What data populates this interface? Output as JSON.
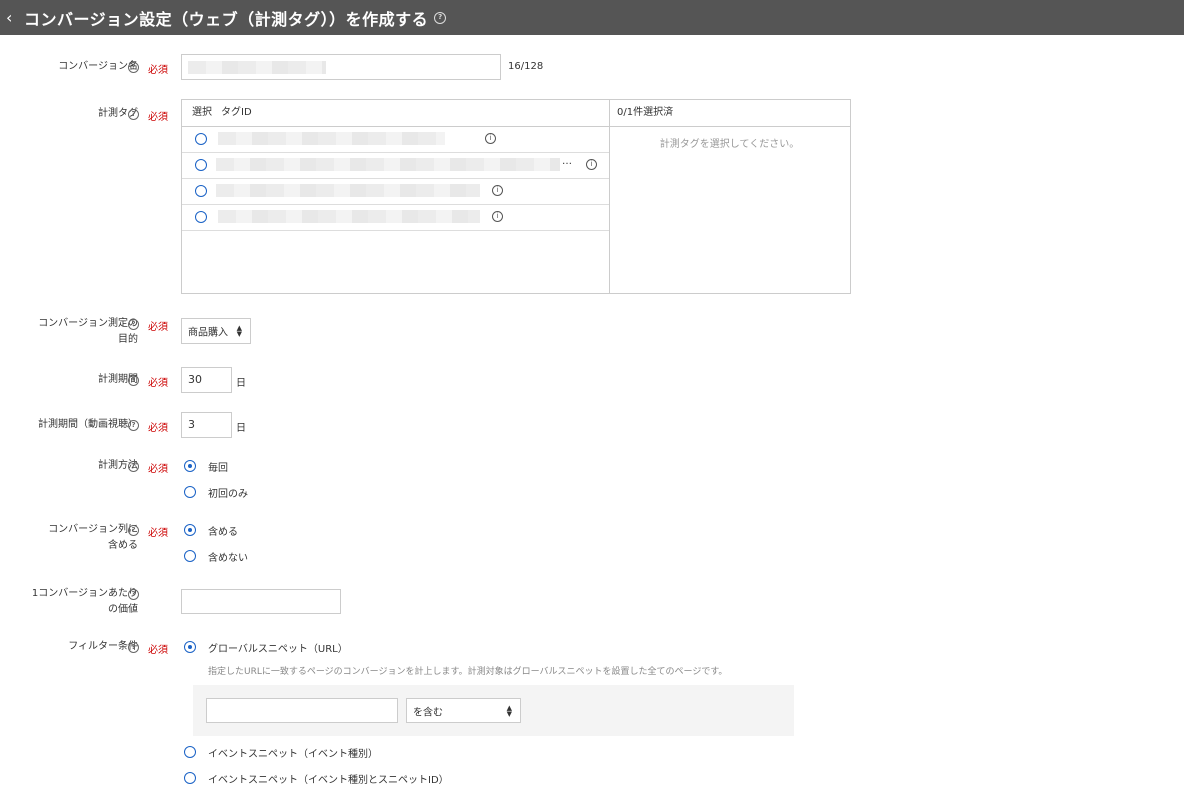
{
  "header": {
    "title": "コンバージョン設定（ウェブ（計測タグ））を作成する"
  },
  "required_label": "必須",
  "conversion_name": {
    "label": "コンバージョン名",
    "counter": "16/128"
  },
  "tag": {
    "label": "計測タグ",
    "col_select": "選択",
    "col_tag_id": "タグID",
    "selected_count": "0/1件選択済",
    "empty_message": "計測タグを選択してください。",
    "row2_ellipsis": "…"
  },
  "purpose": {
    "label_line1": "コンバージョン測定の",
    "label_line2": "目的",
    "value": "商品購入"
  },
  "period": {
    "label": "計測期間",
    "value": "30",
    "unit": "日"
  },
  "video_period": {
    "label": "計測期間（動画視聴）",
    "value": "3",
    "unit": "日"
  },
  "method": {
    "label": "計測方法",
    "options": [
      "毎回",
      "初回のみ"
    ],
    "selected": 0
  },
  "include": {
    "label_line1": "コンバージョン列に",
    "label_line2": "含める",
    "options": [
      "含める",
      "含めない"
    ],
    "selected": 0
  },
  "value_per": {
    "label_line1": "1コンバージョンあたり",
    "label_line2": "の価値",
    "value": ""
  },
  "filter": {
    "label": "フィルター条件",
    "options": [
      "グローバルスニペット（URL）",
      "イベントスニペット（イベント種別）",
      "イベントスニペット（イベント種別とスニペットID）"
    ],
    "selected": 0,
    "hint": "指定したURLに一致するページのコンバージョンを計上します。計測対象はグローバルスニペットを設置した全てのページです。",
    "url_value": "",
    "match_value": "を含む"
  },
  "colors": {
    "header_bg": "#555555",
    "required": "#cc0000",
    "radio": "#1a62c6"
  }
}
